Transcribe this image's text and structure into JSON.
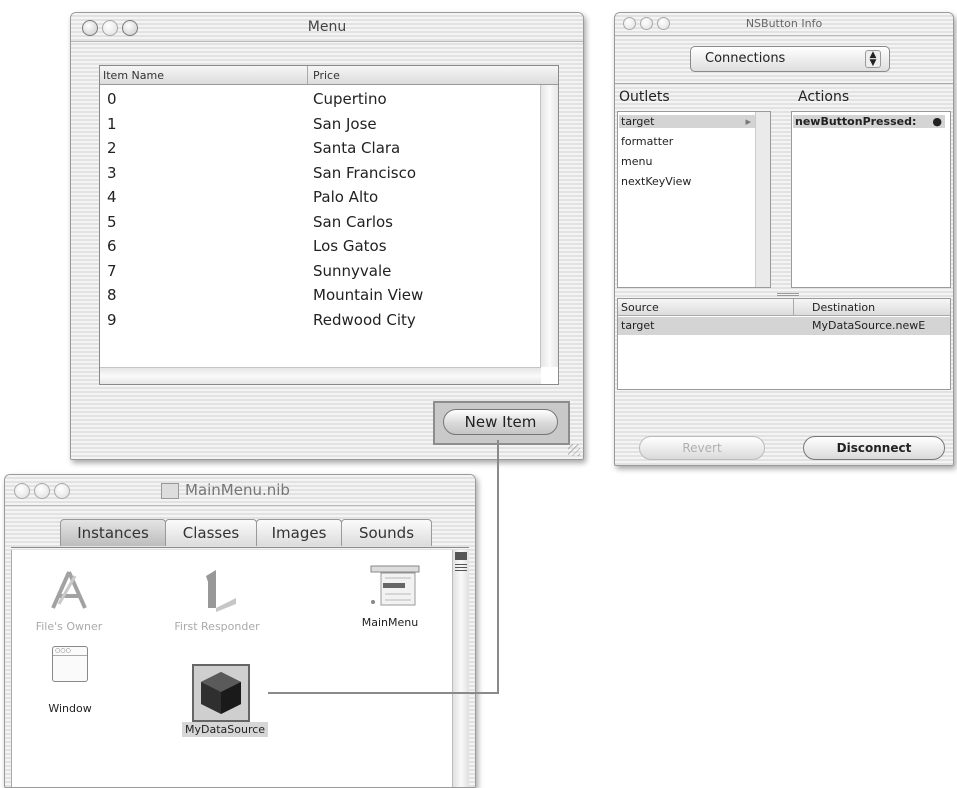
{
  "menu_window": {
    "title": "Menu",
    "columns": [
      "Item Name",
      "Price"
    ],
    "rows": [
      [
        "0",
        "Cupertino"
      ],
      [
        "1",
        "San Jose"
      ],
      [
        "2",
        "Santa Clara"
      ],
      [
        "3",
        "San Francisco"
      ],
      [
        "4",
        "Palo Alto"
      ],
      [
        "5",
        "San Carlos"
      ],
      [
        "6",
        "Los Gatos"
      ],
      [
        "7",
        "Sunnyvale"
      ],
      [
        "8",
        "Mountain View"
      ],
      [
        "9",
        "Redwood City"
      ]
    ],
    "new_item_label": "New Item"
  },
  "info_window": {
    "title": "NSButton Info",
    "popup_value": "Connections",
    "outlets_header": "Outlets",
    "actions_header": "Actions",
    "outlets": [
      "target",
      "formatter",
      "menu",
      "nextKeyView"
    ],
    "actions": [
      "newButtonPressed:"
    ],
    "source_header": "Source",
    "destination_header": "Destination",
    "connection": {
      "source": "target",
      "destination": "MyDataSource.newE"
    },
    "revert_label": "Revert",
    "disconnect_label": "Disconnect"
  },
  "nib_window": {
    "title": "MainMenu.nib",
    "tabs": [
      "Instances",
      "Classes",
      "Images",
      "Sounds"
    ],
    "icons": {
      "files_owner": "File's Owner",
      "first_responder": "First Responder",
      "main_menu": "MainMenu",
      "window": "Window",
      "my_data_source": "MyDataSource"
    }
  }
}
